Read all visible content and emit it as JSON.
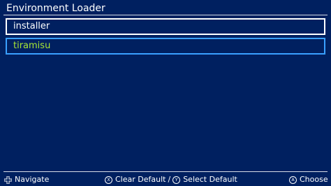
{
  "title": "Environment Loader",
  "entries": [
    {
      "label": "installer"
    },
    {
      "label": "tiramisu"
    }
  ],
  "footer": {
    "navigate": {
      "glyph": "dpad-icon",
      "label": "Navigate"
    },
    "clear_default": {
      "glyph": "X",
      "label": "Clear Default"
    },
    "separator": "/",
    "select_default": {
      "glyph": "Y",
      "label": "Select Default"
    },
    "choose": {
      "glyph": "A",
      "label": "Choose"
    }
  },
  "colors": {
    "background": "#002060",
    "selected_border": "#3aa0ff",
    "selected_text": "#a8e635"
  }
}
